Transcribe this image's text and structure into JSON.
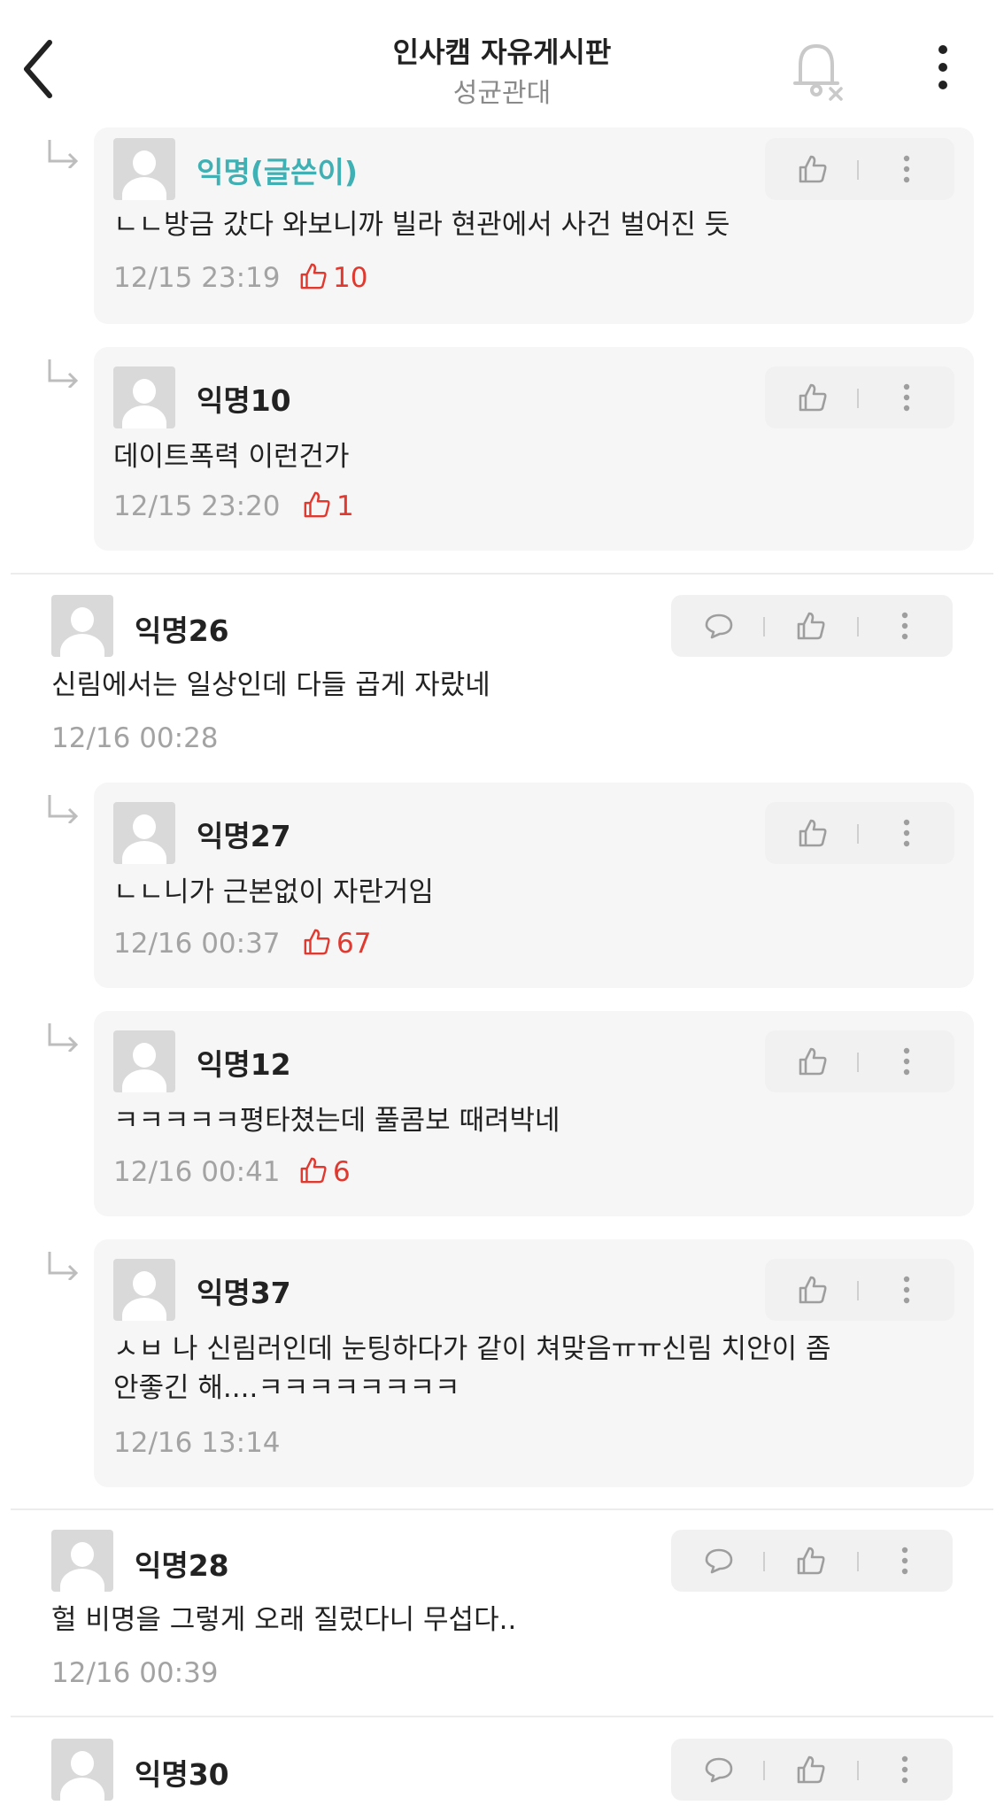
{
  "header": {
    "title": "인사캠 자유게시판",
    "subtitle": "성균관대"
  },
  "comments": [
    {
      "name": "익명(글쓴이)",
      "text": "ㄴㄴ방금 갔다 와보니까 빌라 현관에서 사건 벌어진 듯",
      "time": "12/15 23:19",
      "votes": "10"
    },
    {
      "name": "익명10",
      "text": "데이트폭력 이런건가",
      "time": "12/15 23:20",
      "votes": "1"
    },
    {
      "name": "익명26",
      "text": "신림에서는 일상인데 다들 곱게 자랐네",
      "time": "12/16 00:28"
    },
    {
      "name": "익명27",
      "text": "ㄴㄴ니가 근본없이 자란거임",
      "time": "12/16 00:37",
      "votes": "67"
    },
    {
      "name": "익명12",
      "text": "ㅋㅋㅋㅋㅋ평타쳤는데 풀콤보 때려박네",
      "time": "12/16 00:41",
      "votes": "6"
    },
    {
      "name": "익명37",
      "text_line1": "ㅅㅂ 나 신림러인데 눈팅하다가 같이 쳐맞음ㅠㅠ신림 치안이 좀",
      "text_line2": "안좋긴 해....ㅋㅋㅋㅋㅋㅋㅋㅋ",
      "time": "12/16 13:14"
    },
    {
      "name": "익명28",
      "text": "헐 비명을 그렇게 오래 질렀다니 무섭다..",
      "time": "12/16 00:39"
    },
    {
      "name": "익명30"
    }
  ],
  "colors": {
    "author": "#3fb1b4",
    "vote": "#e0392f",
    "muted": "#a3a3a3"
  },
  "icons": [
    "back-arrow-icon",
    "bell-off-icon",
    "more-vertical-icon",
    "reply-arrow-icon",
    "thumbs-up-icon",
    "chat-bubble-icon"
  ]
}
